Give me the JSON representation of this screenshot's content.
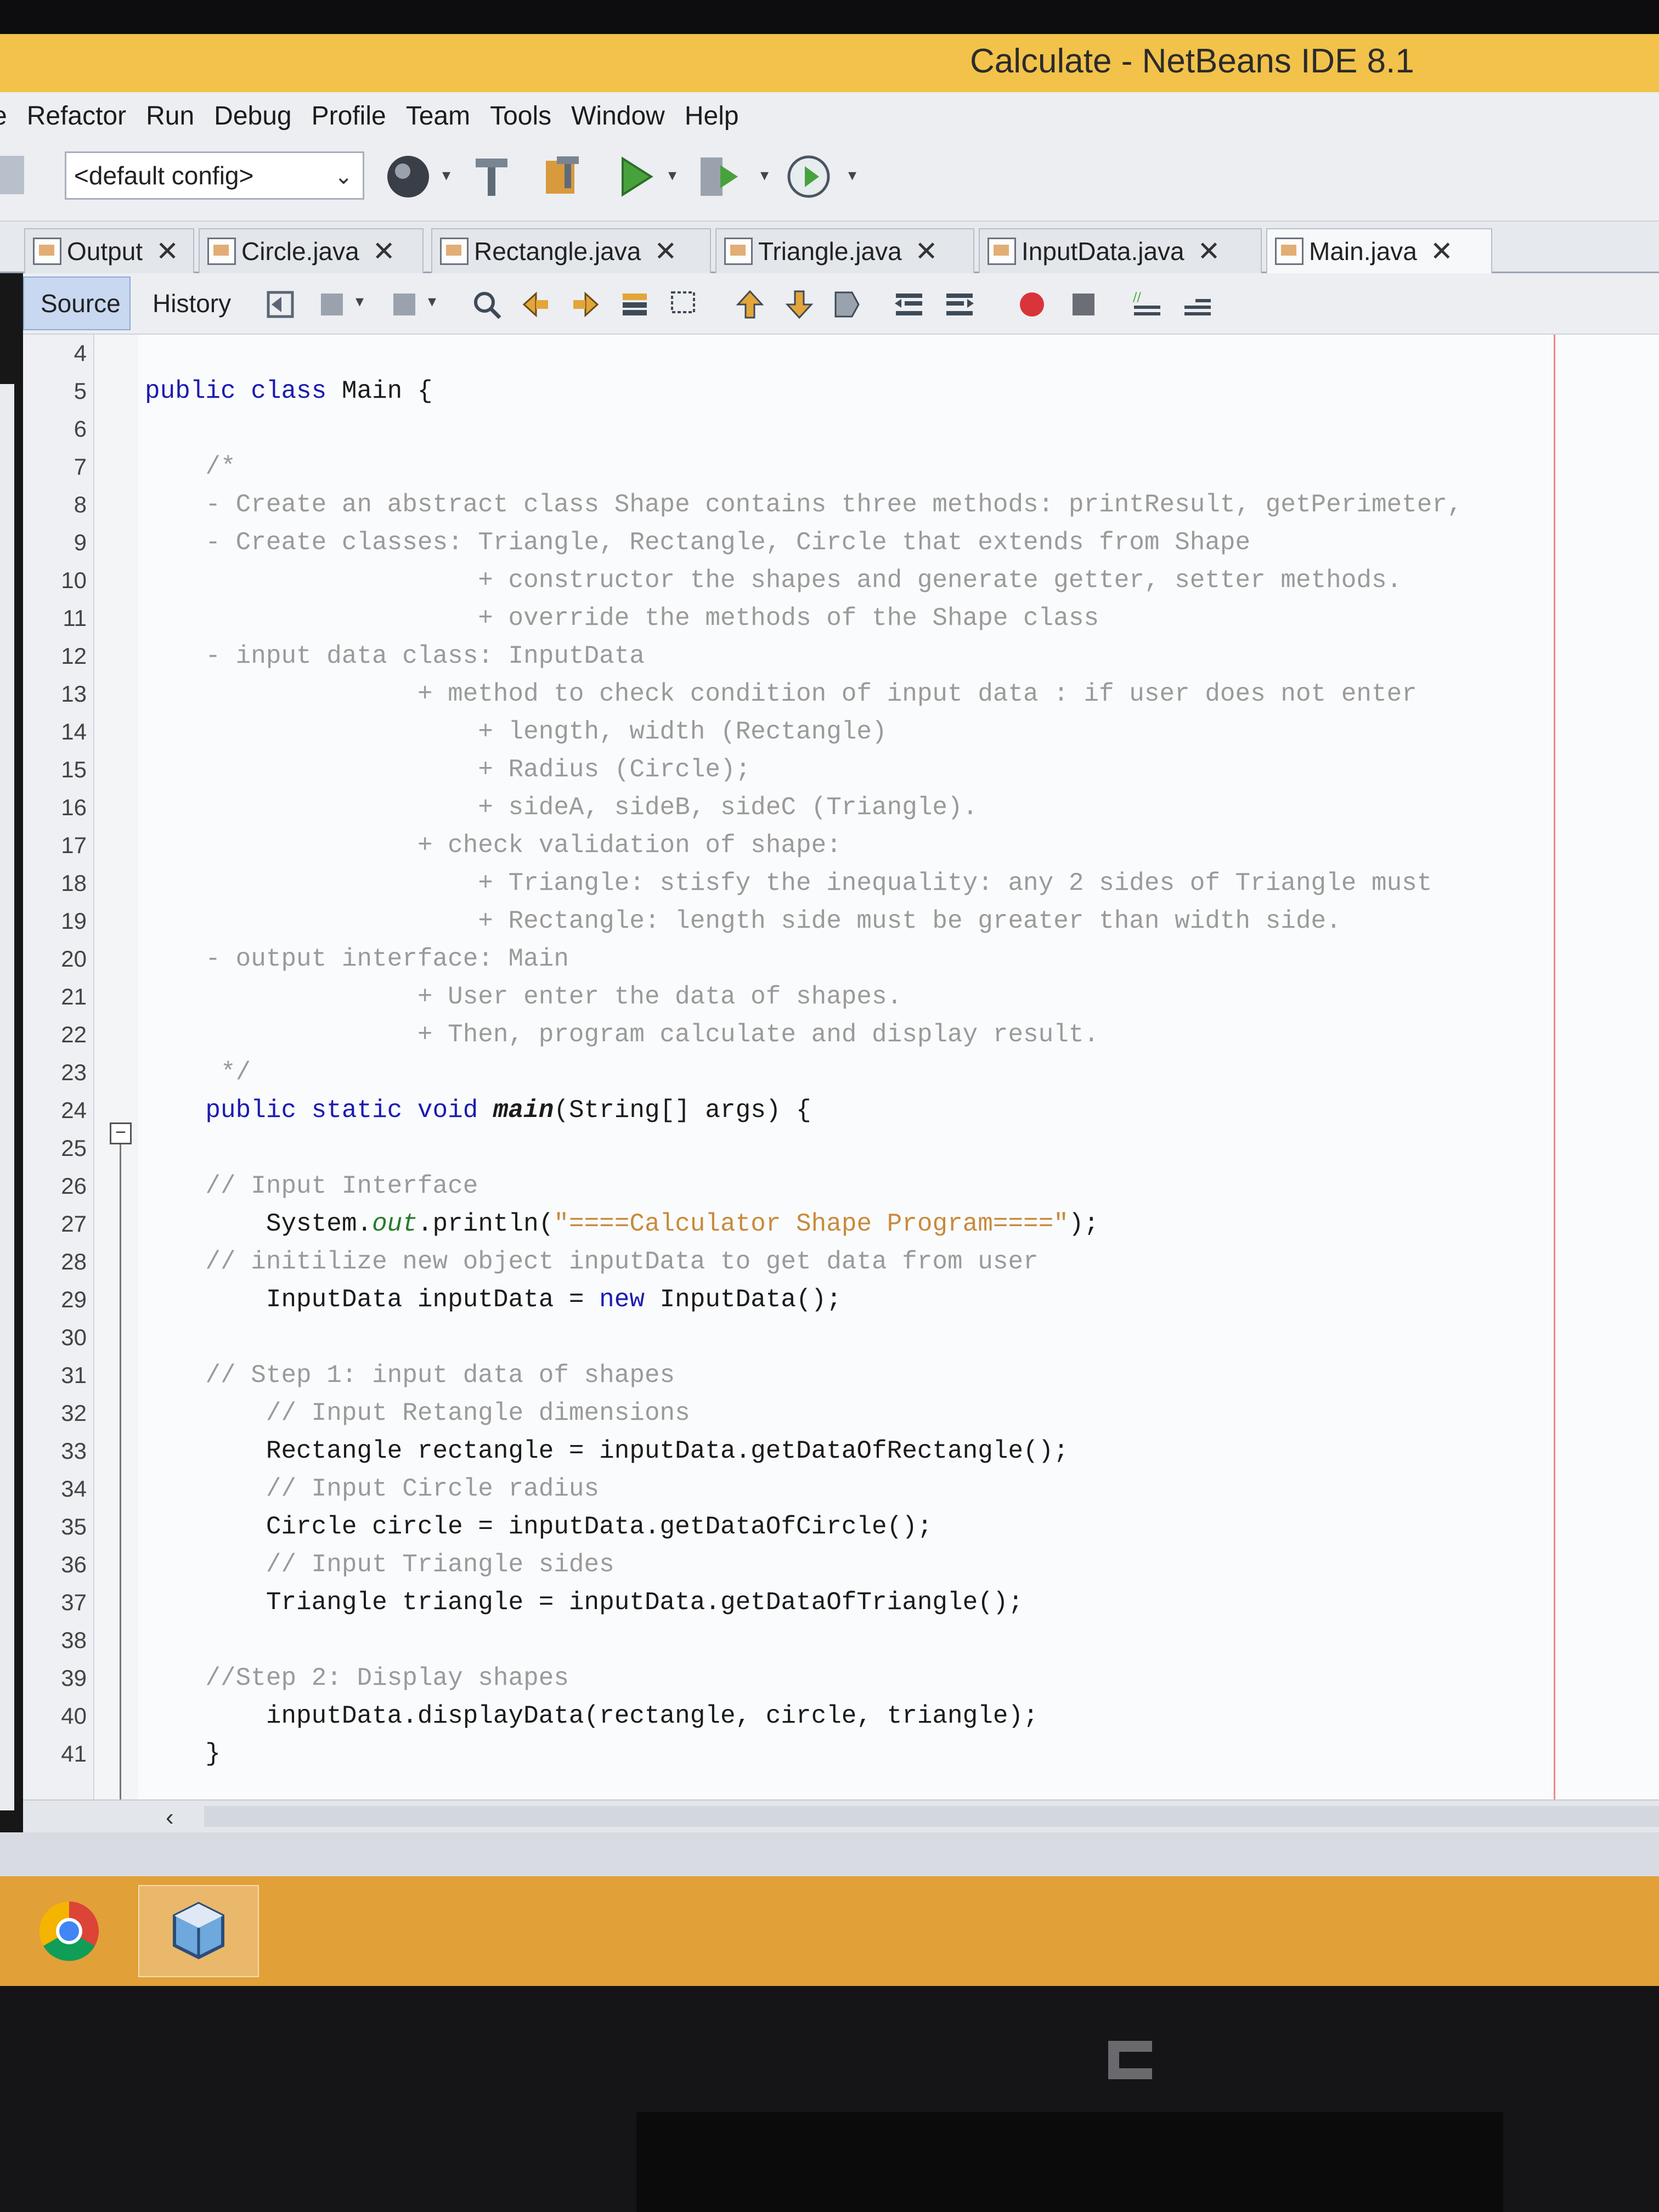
{
  "window": {
    "title": "Calculate - NetBeans IDE 8.1"
  },
  "menu": [
    "e",
    "Refactor",
    "Run",
    "Debug",
    "Profile",
    "Team",
    "Tools",
    "Window",
    "Help"
  ],
  "toolbar": {
    "config_value": "<default config>",
    "icons": [
      "globe-icon",
      "build-hammer-icon",
      "clean-build-icon",
      "run-icon",
      "debug-icon",
      "profile-icon"
    ]
  },
  "tabs": [
    {
      "label": "Output",
      "active": false
    },
    {
      "label": "Circle.java",
      "active": false
    },
    {
      "label": "Rectangle.java",
      "active": false
    },
    {
      "label": "Triangle.java",
      "active": false
    },
    {
      "label": "InputData.java",
      "active": false
    },
    {
      "label": "Main.java",
      "active": true
    }
  ],
  "editor_toolbar": {
    "source_label": "Source",
    "history_label": "History"
  },
  "code_lines": [
    {
      "n": "4",
      "text": ""
    },
    {
      "n": "5",
      "text": "public class Main {"
    },
    {
      "n": "6",
      "text": ""
    },
    {
      "n": "7",
      "text": "    /*"
    },
    {
      "n": "8",
      "text": "    - Create an abstract class Shape contains three methods: printResult, getPerimeter,"
    },
    {
      "n": "9",
      "text": "    - Create classes: Triangle, Rectangle, Circle that extends from Shape"
    },
    {
      "n": "10",
      "text": "                      + constructor the shapes and generate getter, setter methods."
    },
    {
      "n": "11",
      "text": "                      + override the methods of the Shape class"
    },
    {
      "n": "12",
      "text": "    - input data class: InputData"
    },
    {
      "n": "13",
      "text": "                  + method to check condition of input data : if user does not enter"
    },
    {
      "n": "14",
      "text": "                      + length, width (Rectangle)"
    },
    {
      "n": "15",
      "text": "                      + Radius (Circle);"
    },
    {
      "n": "16",
      "text": "                      + sideA, sideB, sideC (Triangle)."
    },
    {
      "n": "17",
      "text": "                  + check validation of shape:"
    },
    {
      "n": "18",
      "text": "                      + Triangle: stisfy the inequality: any 2 sides of Triangle must"
    },
    {
      "n": "19",
      "text": "                      + Rectangle: length side must be greater than width side."
    },
    {
      "n": "20",
      "text": "    - output interface: Main"
    },
    {
      "n": "21",
      "text": "                  + User enter the data of shapes."
    },
    {
      "n": "22",
      "text": "                  + Then, program calculate and display result."
    },
    {
      "n": "23",
      "text": "     */"
    },
    {
      "n": "24",
      "text": "    public static void main(String[] args) {"
    },
    {
      "n": "25",
      "text": ""
    },
    {
      "n": "26",
      "text": "    // Input Interface"
    },
    {
      "n": "27",
      "text": "        System.out.println(\"====Calculator Shape Program====\");"
    },
    {
      "n": "28",
      "text": "    // initilize new object inputData to get data from user"
    },
    {
      "n": "29",
      "text": "        InputData inputData = new InputData();"
    },
    {
      "n": "30",
      "text": ""
    },
    {
      "n": "31",
      "text": "    // Step 1: input data of shapes"
    },
    {
      "n": "32",
      "text": "        // Input Retangle dimensions"
    },
    {
      "n": "33",
      "text": "        Rectangle rectangle = inputData.getDataOfRectangle();"
    },
    {
      "n": "34",
      "text": "        // Input Circle radius"
    },
    {
      "n": "35",
      "text": "        Circle circle = inputData.getDataOfCircle();"
    },
    {
      "n": "36",
      "text": "        // Input Triangle sides"
    },
    {
      "n": "37",
      "text": "        Triangle triangle = inputData.getDataOfTriangle();"
    },
    {
      "n": "38",
      "text": ""
    },
    {
      "n": "39",
      "text": "    //Step 2: Display shapes"
    },
    {
      "n": "40",
      "text": "        inputData.displayData(rectangle, circle, triangle);"
    },
    {
      "n": "41",
      "text": "    }"
    }
  ],
  "taskbar": {
    "apps": [
      "chrome-icon",
      "virtualbox-icon"
    ]
  },
  "colors": {
    "titlebar": "#f2c24a",
    "taskbar": "#e2a038",
    "keyword": "#1b1bb0",
    "comment": "#9a9a9a",
    "string": "#c98a3c"
  }
}
